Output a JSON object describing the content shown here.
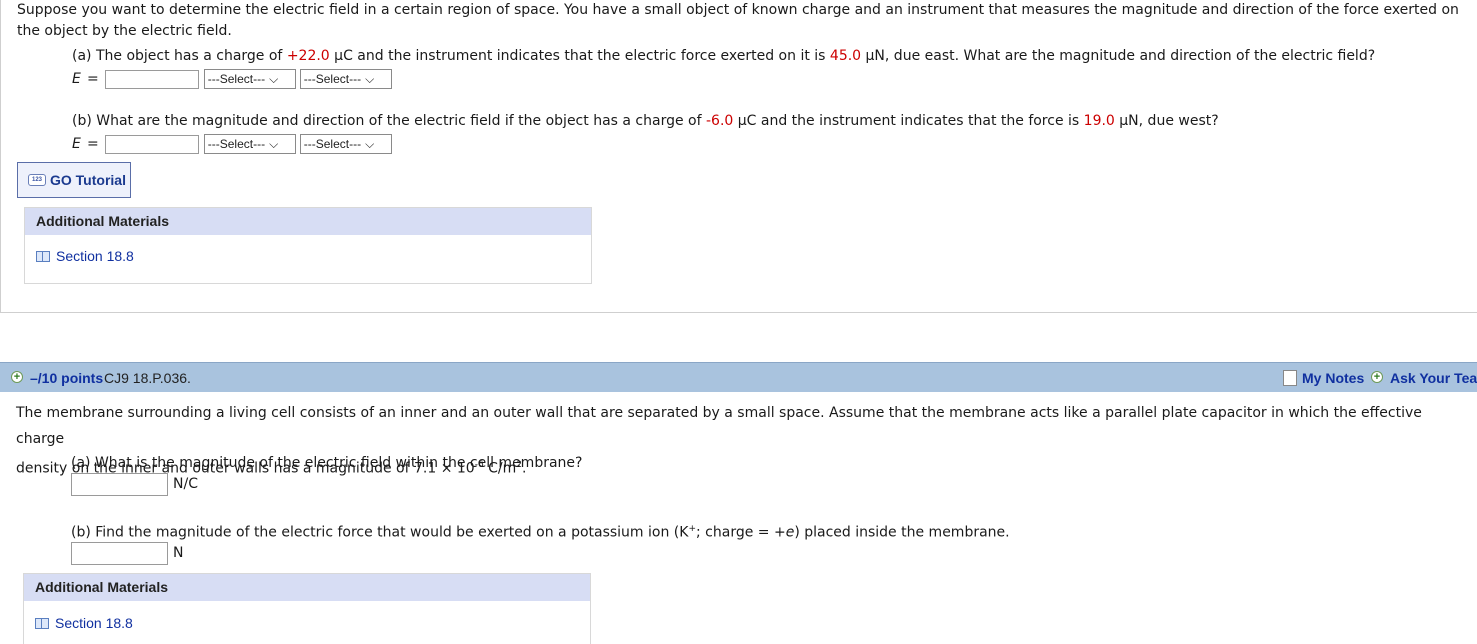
{
  "q1": {
    "intro": "Suppose you want to determine the electric field in a certain region of space. You have a small object of known charge and an instrument that measures the magnitude and direction of the force exerted on the object by the electric field.",
    "a": {
      "t1": "(a) The object has a charge of ",
      "charge": "+22.0",
      "t2": " µC and the instrument indicates that the electric force exerted on it is ",
      "force": "45.0",
      "t3": " µN, due east. What are the magnitude and direction of the electric field?"
    },
    "b": {
      "t1": "(b) What are the magnitude and direction of the electric field if the object has a charge of ",
      "charge": "-6.0",
      "t2": " µC and the instrument indicates that the force is ",
      "force": "19.0",
      "t3": " µN, due west?"
    },
    "answer_label": "E",
    "equals": "=",
    "select_placeholder": "---Select---",
    "go_tutorial": "GO Tutorial",
    "go_icon_text": "123",
    "additional_materials": "Additional Materials",
    "section_link": "Section 18.8"
  },
  "q2": {
    "points": "–/10 points",
    "problem_id": "CJ9 18.P.036.",
    "my_notes": "My Notes",
    "ask_teacher": "Ask Your Teac",
    "intro_1": "The membrane surrounding a living cell consists of an inner and an outer wall that are separated by a small space. Assume that the membrane acts like a parallel plate capacitor in which the effective charge",
    "intro_2a": "density on the inner and outer walls has a magnitude of 7.1 × 10",
    "intro_2exp": "-6",
    "intro_2b": " C/m",
    "intro_2exp2": "2",
    "intro_2c": ".",
    "a": "(a) What is the magnitude of the electric field within the cell membrane?",
    "a_unit": "N/C",
    "b1": "(b) Find the magnitude of the electric force that would be exerted on a potassium ion (K",
    "b_sup": "+",
    "b2": "; charge = +",
    "b_e": "e",
    "b3": ") placed inside the membrane.",
    "b_unit": "N",
    "additional_materials": "Additional Materials",
    "section_link": "Section 18.8"
  },
  "colors": {
    "highlight_red": "#cc0000",
    "bar_blue": "#a9c3de",
    "materials_header": "#d7ddf4",
    "link_blue": "#1030a0"
  }
}
